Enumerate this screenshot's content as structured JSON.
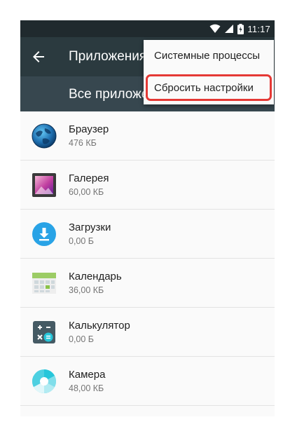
{
  "status_bar": {
    "time": "11:17"
  },
  "toolbar": {
    "title": "Приложения"
  },
  "tab": {
    "title": "Все приложения"
  },
  "overflow_menu": {
    "items": [
      {
        "label": "Системные процессы"
      },
      {
        "label": "Сбросить настройки"
      }
    ]
  },
  "apps": [
    {
      "name": "Браузер",
      "size": "476 КБ",
      "icon": "browser-globe-icon"
    },
    {
      "name": "Галерея",
      "size": "60,00 КБ",
      "icon": "gallery-icon"
    },
    {
      "name": "Загрузки",
      "size": "0,00 Б",
      "icon": "download-icon"
    },
    {
      "name": "Календарь",
      "size": "36,00 КБ",
      "icon": "calendar-icon"
    },
    {
      "name": "Калькулятор",
      "size": "0,00 Б",
      "icon": "calculator-icon"
    },
    {
      "name": "Камера",
      "size": "48,00 КБ",
      "icon": "camera-icon"
    }
  ],
  "colors": {
    "toolbar": "#2b3a3f",
    "tabbar": "#37474f",
    "status_bar": "#202a2e",
    "highlight": "#e53935"
  }
}
